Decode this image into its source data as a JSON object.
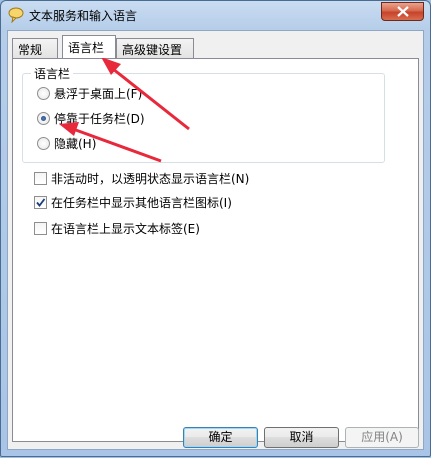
{
  "window": {
    "title": "文本服务和输入语言"
  },
  "tabs": [
    {
      "label": "常规",
      "active": false
    },
    {
      "label": "语言栏",
      "active": true
    },
    {
      "label": "高级键设置",
      "active": false
    }
  ],
  "language_bar_group": {
    "label": "语言栏",
    "options": [
      {
        "label": "悬浮于桌面上(F)",
        "selected": false
      },
      {
        "label": "停靠于任务栏(D)",
        "selected": true
      },
      {
        "label": "隐藏(H)",
        "selected": false
      }
    ]
  },
  "checkboxes": [
    {
      "label": "非活动时，以透明状态显示语言栏(N)",
      "checked": false
    },
    {
      "label": "在任务栏中显示其他语言栏图标(I)",
      "checked": true
    },
    {
      "label": "在语言栏上显示文本标签(E)",
      "checked": false
    }
  ],
  "buttons": {
    "ok": "确定",
    "cancel": "取消",
    "apply": "应用(A)"
  },
  "colors": {
    "annotation_arrow": "#e8283b",
    "accent": "#3c7fb1"
  }
}
